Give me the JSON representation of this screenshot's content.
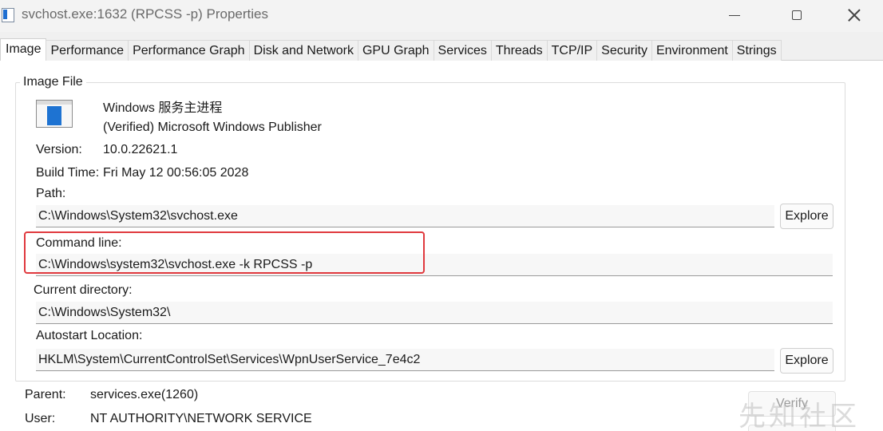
{
  "window": {
    "title": "svchost.exe:1632 (RPCSS -p) Properties"
  },
  "tabs": [
    {
      "label": "Image"
    },
    {
      "label": "Performance"
    },
    {
      "label": "Performance Graph"
    },
    {
      "label": "Disk and Network"
    },
    {
      "label": "GPU Graph"
    },
    {
      "label": "Services"
    },
    {
      "label": "Threads"
    },
    {
      "label": "TCP/IP"
    },
    {
      "label": "Security"
    },
    {
      "label": "Environment"
    },
    {
      "label": "Strings"
    }
  ],
  "image_file": {
    "group_title": "Image File",
    "description": "Windows 服务主进程",
    "company": "(Verified) Microsoft Windows Publisher",
    "version_label": "Version:",
    "version_value": "10.0.22621.1",
    "build_time_label": "Build Time:",
    "build_time_value": "Fri May 12 00:56:05 2028",
    "path_label": "Path:",
    "path_value": "C:\\Windows\\System32\\svchost.exe",
    "explore_label": "Explore",
    "command_line_label": "Command line:",
    "command_line_value": "C:\\Windows\\system32\\svchost.exe -k RPCSS -p",
    "current_dir_label": "Current directory:",
    "current_dir_value": "C:\\Windows\\System32\\",
    "autostart_label": "Autostart Location:",
    "autostart_value": "HKLM\\System\\CurrentControlSet\\Services\\WpnUserService_7e4c2",
    "explore2_label": "Explore"
  },
  "process": {
    "parent_label": "Parent:",
    "parent_value": "services.exe(1260)",
    "user_label": "User:",
    "user_value": "NT AUTHORITY\\NETWORK SERVICE",
    "verify_label": "Verify"
  },
  "watermark": "先知社区",
  "colors": {
    "highlight": "#e0393e",
    "icon_blue": "#1e73d2"
  }
}
